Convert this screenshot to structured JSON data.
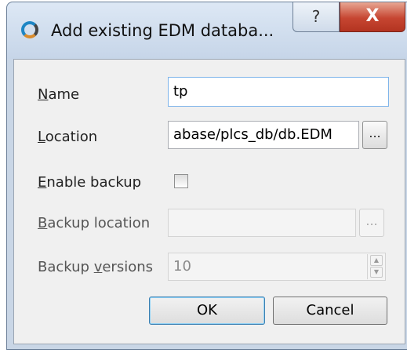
{
  "window": {
    "title": "Add existing EDM databa...",
    "help_label": "?",
    "close_label": "X"
  },
  "form": {
    "name_label_accel": "N",
    "name_label_rest": "ame",
    "name_value": "tp",
    "location_label_accel": "L",
    "location_label_rest": "ocation",
    "location_value": "abase/plcs_db/db.EDM",
    "browse_label": "...",
    "enable_backup_label_accel": "E",
    "enable_backup_label_rest": "nable backup",
    "enable_backup_checked": false,
    "backup_location_label_accel": "B",
    "backup_location_label_rest": "ackup location",
    "backup_location_value": "",
    "backup_versions_label_pre": "Backup ",
    "backup_versions_label_accel": "v",
    "backup_versions_label_rest": "ersions",
    "backup_versions_value": "10"
  },
  "buttons": {
    "ok_label": "OK",
    "cancel_label": "Cancel"
  },
  "colors": {
    "close_red": "#c64531",
    "focus_blue": "#7eb4ea"
  }
}
